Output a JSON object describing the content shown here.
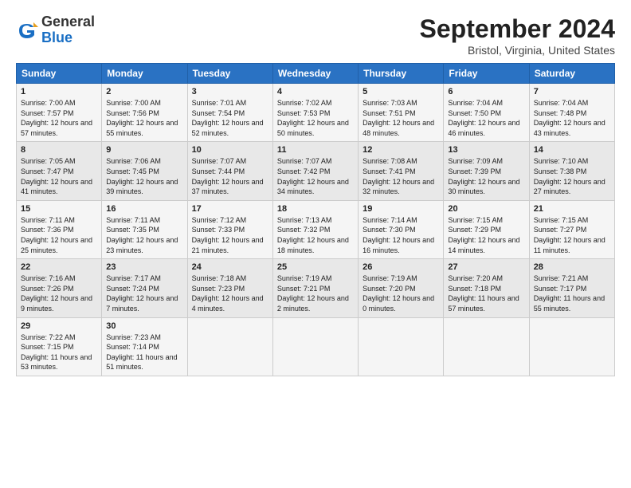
{
  "header": {
    "logo_line1": "General",
    "logo_line2": "Blue",
    "title": "September 2024",
    "subtitle": "Bristol, Virginia, United States"
  },
  "days_of_week": [
    "Sunday",
    "Monday",
    "Tuesday",
    "Wednesday",
    "Thursday",
    "Friday",
    "Saturday"
  ],
  "weeks": [
    [
      {
        "num": "1",
        "sunrise": "7:00 AM",
        "sunset": "7:57 PM",
        "daylight": "12 hours and 57 minutes."
      },
      {
        "num": "2",
        "sunrise": "7:00 AM",
        "sunset": "7:56 PM",
        "daylight": "12 hours and 55 minutes."
      },
      {
        "num": "3",
        "sunrise": "7:01 AM",
        "sunset": "7:54 PM",
        "daylight": "12 hours and 52 minutes."
      },
      {
        "num": "4",
        "sunrise": "7:02 AM",
        "sunset": "7:53 PM",
        "daylight": "12 hours and 50 minutes."
      },
      {
        "num": "5",
        "sunrise": "7:03 AM",
        "sunset": "7:51 PM",
        "daylight": "12 hours and 48 minutes."
      },
      {
        "num": "6",
        "sunrise": "7:04 AM",
        "sunset": "7:50 PM",
        "daylight": "12 hours and 46 minutes."
      },
      {
        "num": "7",
        "sunrise": "7:04 AM",
        "sunset": "7:48 PM",
        "daylight": "12 hours and 43 minutes."
      }
    ],
    [
      {
        "num": "8",
        "sunrise": "7:05 AM",
        "sunset": "7:47 PM",
        "daylight": "12 hours and 41 minutes."
      },
      {
        "num": "9",
        "sunrise": "7:06 AM",
        "sunset": "7:45 PM",
        "daylight": "12 hours and 39 minutes."
      },
      {
        "num": "10",
        "sunrise": "7:07 AM",
        "sunset": "7:44 PM",
        "daylight": "12 hours and 37 minutes."
      },
      {
        "num": "11",
        "sunrise": "7:07 AM",
        "sunset": "7:42 PM",
        "daylight": "12 hours and 34 minutes."
      },
      {
        "num": "12",
        "sunrise": "7:08 AM",
        "sunset": "7:41 PM",
        "daylight": "12 hours and 32 minutes."
      },
      {
        "num": "13",
        "sunrise": "7:09 AM",
        "sunset": "7:39 PM",
        "daylight": "12 hours and 30 minutes."
      },
      {
        "num": "14",
        "sunrise": "7:10 AM",
        "sunset": "7:38 PM",
        "daylight": "12 hours and 27 minutes."
      }
    ],
    [
      {
        "num": "15",
        "sunrise": "7:11 AM",
        "sunset": "7:36 PM",
        "daylight": "12 hours and 25 minutes."
      },
      {
        "num": "16",
        "sunrise": "7:11 AM",
        "sunset": "7:35 PM",
        "daylight": "12 hours and 23 minutes."
      },
      {
        "num": "17",
        "sunrise": "7:12 AM",
        "sunset": "7:33 PM",
        "daylight": "12 hours and 21 minutes."
      },
      {
        "num": "18",
        "sunrise": "7:13 AM",
        "sunset": "7:32 PM",
        "daylight": "12 hours and 18 minutes."
      },
      {
        "num": "19",
        "sunrise": "7:14 AM",
        "sunset": "7:30 PM",
        "daylight": "12 hours and 16 minutes."
      },
      {
        "num": "20",
        "sunrise": "7:15 AM",
        "sunset": "7:29 PM",
        "daylight": "12 hours and 14 minutes."
      },
      {
        "num": "21",
        "sunrise": "7:15 AM",
        "sunset": "7:27 PM",
        "daylight": "12 hours and 11 minutes."
      }
    ],
    [
      {
        "num": "22",
        "sunrise": "7:16 AM",
        "sunset": "7:26 PM",
        "daylight": "12 hours and 9 minutes."
      },
      {
        "num": "23",
        "sunrise": "7:17 AM",
        "sunset": "7:24 PM",
        "daylight": "12 hours and 7 minutes."
      },
      {
        "num": "24",
        "sunrise": "7:18 AM",
        "sunset": "7:23 PM",
        "daylight": "12 hours and 4 minutes."
      },
      {
        "num": "25",
        "sunrise": "7:19 AM",
        "sunset": "7:21 PM",
        "daylight": "12 hours and 2 minutes."
      },
      {
        "num": "26",
        "sunrise": "7:19 AM",
        "sunset": "7:20 PM",
        "daylight": "12 hours and 0 minutes."
      },
      {
        "num": "27",
        "sunrise": "7:20 AM",
        "sunset": "7:18 PM",
        "daylight": "11 hours and 57 minutes."
      },
      {
        "num": "28",
        "sunrise": "7:21 AM",
        "sunset": "7:17 PM",
        "daylight": "11 hours and 55 minutes."
      }
    ],
    [
      {
        "num": "29",
        "sunrise": "7:22 AM",
        "sunset": "7:15 PM",
        "daylight": "11 hours and 53 minutes."
      },
      {
        "num": "30",
        "sunrise": "7:23 AM",
        "sunset": "7:14 PM",
        "daylight": "11 hours and 51 minutes."
      },
      null,
      null,
      null,
      null,
      null
    ]
  ]
}
